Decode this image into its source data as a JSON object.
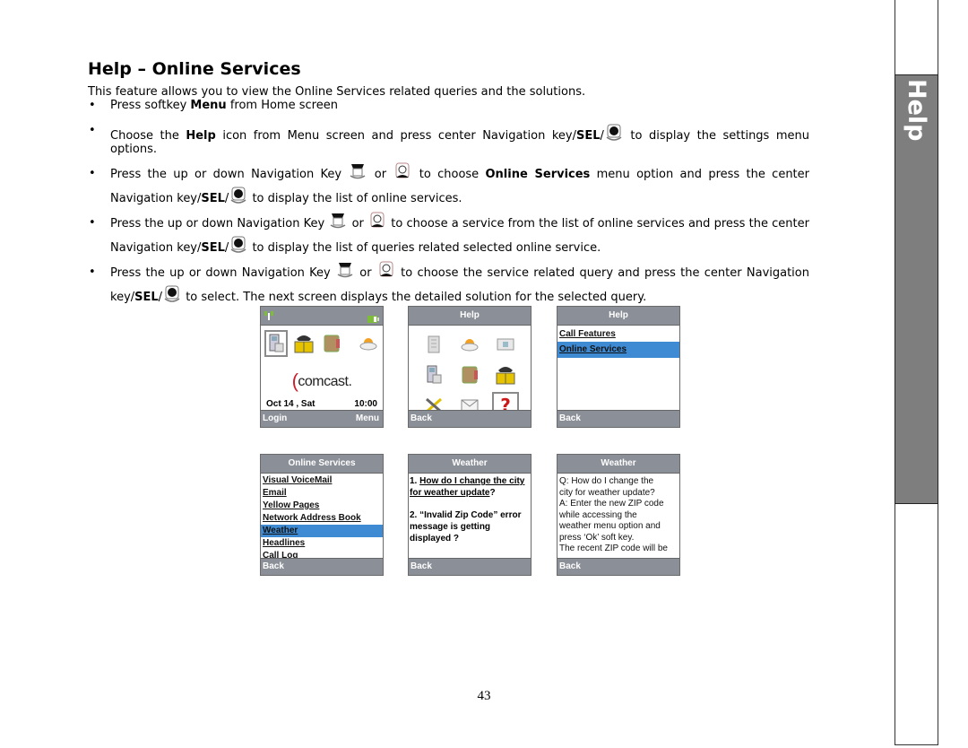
{
  "page": {
    "title": "Help – Online Services",
    "intro": "This feature allows you to view the Online Services related queries and the solutions.",
    "bullets": [
      {
        "pre": "Press softkey ",
        "bold": "Menu",
        "post": " from Home screen"
      },
      {
        "pre": "Choose the ",
        "bold": "Help",
        "mid": " icon from Menu screen and press center Navigation key/",
        "bold2": "SEL",
        "post": "/",
        "post2": " to display the settings menu options."
      },
      {
        "pre": "Press the up or down Navigation Key ",
        "or": " or ",
        "mid": " to choose ",
        "bold": "Online Services",
        "mid2": " menu option and press the center Navigation key/",
        "bold2": "SEL",
        "post": "/",
        "post2": " to display the list of online services."
      },
      {
        "pre": "Press the up or down Navigation Key ",
        "or": " or ",
        "mid": " to choose a service from the list of online services and press the center Navigation key/",
        "bold2": "SEL",
        "post": "/",
        "post2": " to display the list of queries related selected online service."
      },
      {
        "pre": "Press the up or down Navigation Key ",
        "or": " or ",
        "mid": "  to choose the service related query and press the center Navigation key/",
        "bold2": "SEL",
        "post": "/",
        "post2": " to select. The next screen displays the detailed solution for the selected query."
      }
    ],
    "page_number": "43",
    "side_tab": "Help"
  },
  "screens": {
    "home": {
      "brand": "comcast.",
      "date": "Oct 14 , Sat",
      "time": "10:00",
      "left_softkey": "Login",
      "right_softkey": "Menu"
    },
    "help_menu": {
      "title": "Help",
      "left_softkey": "Back"
    },
    "help_list": {
      "title": "Help",
      "items": [
        "Call Features",
        "Online Services"
      ],
      "selected": 1,
      "left_softkey": "Back"
    },
    "online_services": {
      "title": "Online Services",
      "items": [
        "Visual VoiceMail",
        "Email",
        "Yellow Pages",
        "Network Address Book",
        "Weather",
        "Headlines",
        "Call Log"
      ],
      "selected": 4,
      "left_softkey": "Back"
    },
    "weather_queries": {
      "title": "Weather",
      "q1_num": "1. ",
      "q1_link": "How do I change the city for weather update",
      "q1_tail": "?",
      "q2": "2. “Invalid Zip Code” error message is getting displayed ?",
      "left_softkey": "Back"
    },
    "weather_answer": {
      "title": "Weather",
      "lines": [
        " Q: How do I change the",
        "city for weather update?",
        "A: Enter the new ZIP code",
        "while accessing the",
        "weather menu option and",
        "press ‘Ok’ soft key.",
        "The recent ZIP code will be"
      ],
      "left_softkey": "Back"
    }
  },
  "colors": {
    "header_bar": "#8b8f98",
    "selection": "#3e8bd3",
    "side_tab": "#7e7e7e"
  }
}
